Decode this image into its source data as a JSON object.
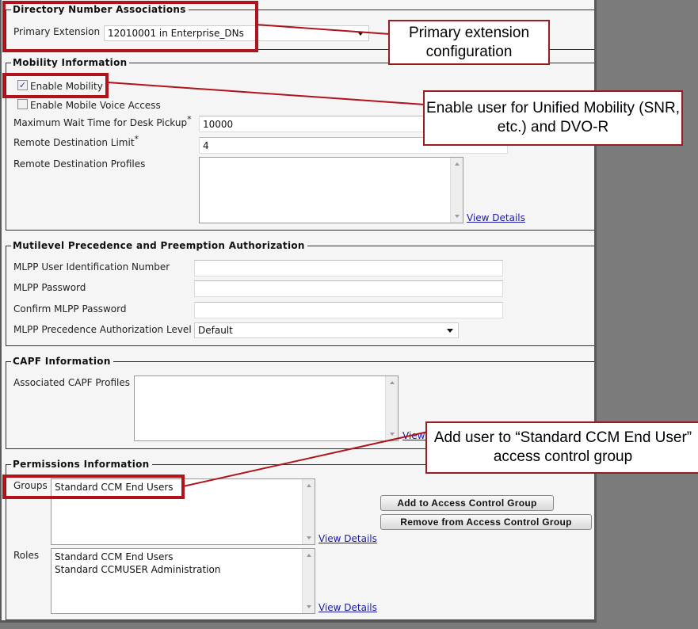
{
  "sections": {
    "directory": {
      "legend": "Directory Number Associations",
      "primary_extension_label": "Primary Extension",
      "primary_extension_value": "12010001 in Enterprise_DNs"
    },
    "mobility": {
      "legend": "Mobility Information",
      "enable_mobility_label": "Enable Mobility",
      "enable_mobility_checked": true,
      "enable_mva_label": "Enable Mobile Voice Access",
      "enable_mva_checked": false,
      "max_wait_label": "Maximum Wait Time for Desk Pickup",
      "max_wait_value": "10000",
      "rd_limit_label": "Remote Destination Limit",
      "rd_limit_value": "4",
      "rdp_label": "Remote Destination Profiles",
      "rdp_items": [],
      "view_details": "View Details",
      "required_mark": "*"
    },
    "mlpp": {
      "legend": "Mutilevel Precedence and Preemption Authorization",
      "user_id_label": "MLPP User Identification Number",
      "user_id_value": "",
      "password_label": "MLPP Password",
      "password_value": "",
      "confirm_label": "Confirm MLPP Password",
      "confirm_value": "",
      "level_label": "MLPP Precedence Authorization Level",
      "level_value": "Default"
    },
    "capf": {
      "legend": "CAPF Information",
      "profiles_label": "Associated CAPF Profiles",
      "profiles_items": [],
      "view_details": "View Details"
    },
    "permissions": {
      "legend": "Permissions Information",
      "groups_label": "Groups",
      "groups_items": [
        "Standard CCM End Users"
      ],
      "groups_view_details": "View Details",
      "add_button": "Add to Access Control Group",
      "remove_button": "Remove from Access Control Group",
      "roles_label": "Roles",
      "roles_items": [
        "Standard CCM End Users",
        "Standard CCMUSER Administration"
      ],
      "roles_view_details": "View Details"
    }
  },
  "callouts": {
    "primary_extension": "Primary extension configuration",
    "mobility": "Enable user for Unified Mobility (SNR, etc.) and DVO-R",
    "groups": "Add user to “Standard CCM End User” access control group"
  },
  "colors": {
    "highlight": "#b0141a",
    "callout_border": "#9b1b1f",
    "link": "#1a1aa6",
    "background": "#7a7b7a"
  }
}
